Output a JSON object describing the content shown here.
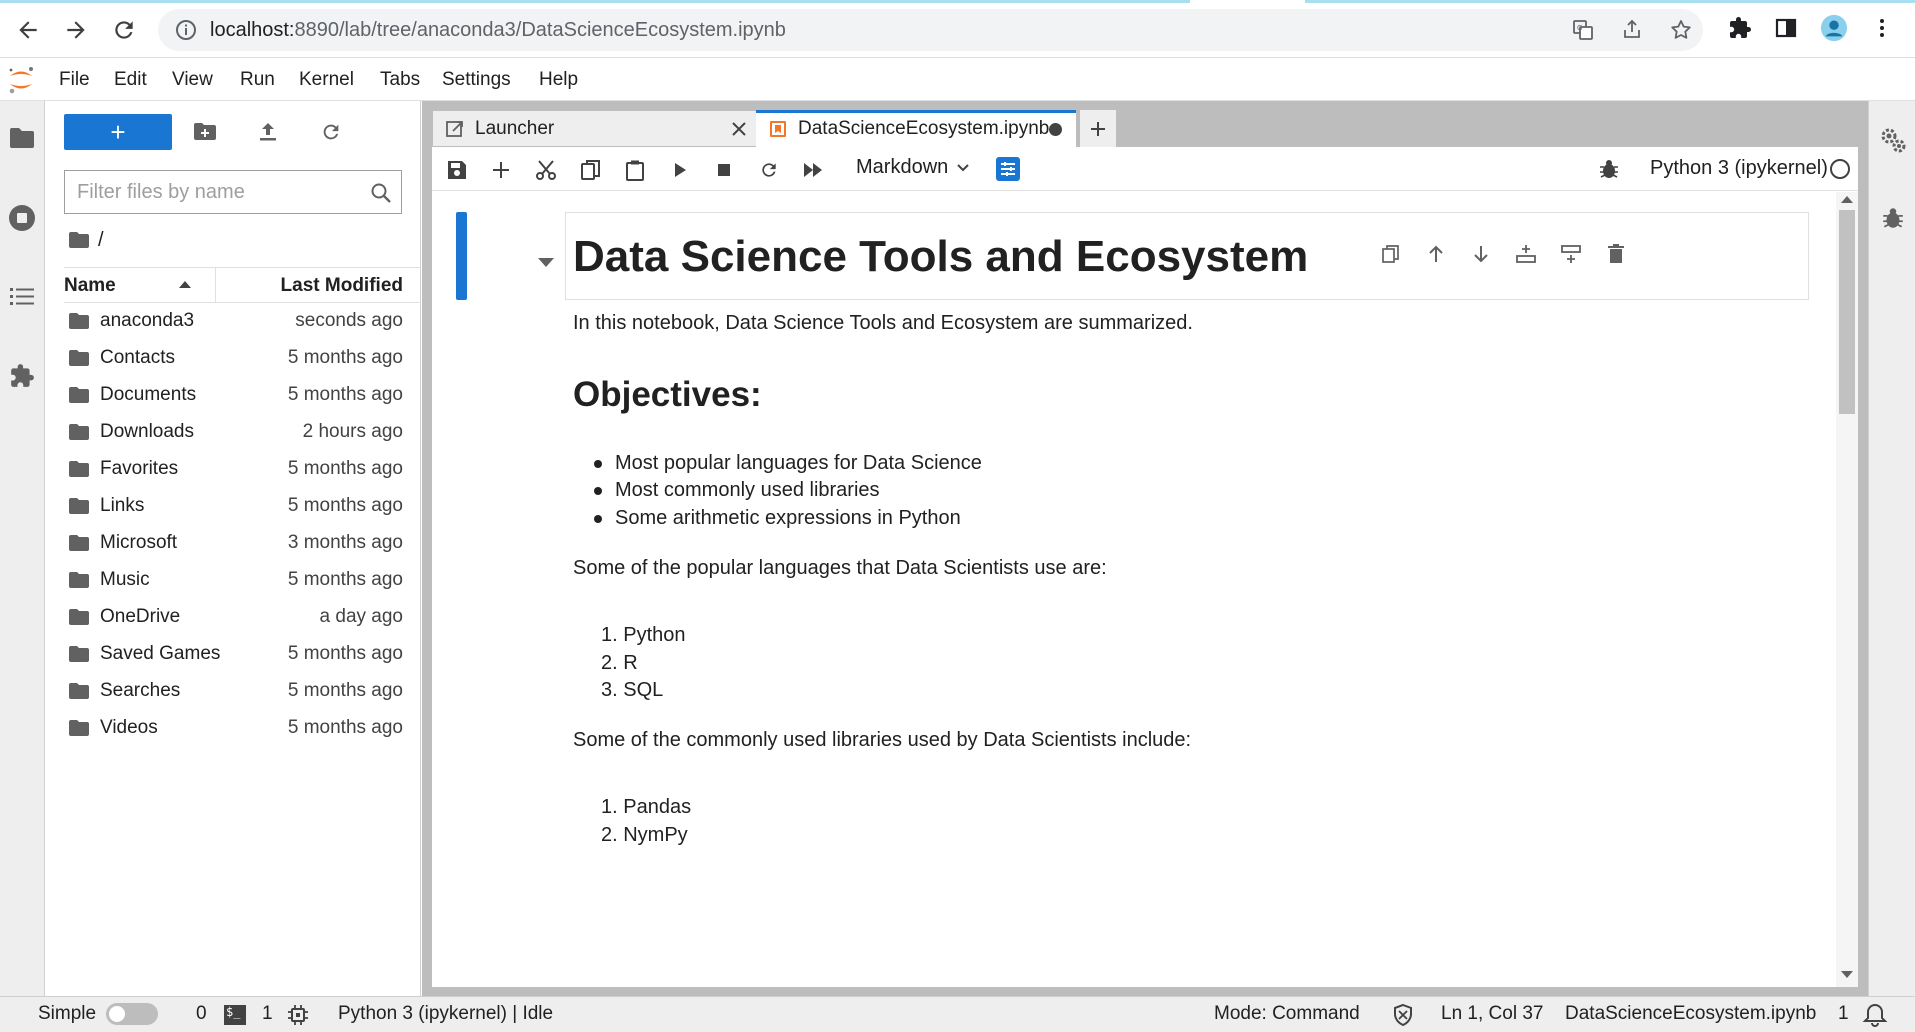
{
  "browser": {
    "url_host": "localhost:",
    "url_rest": "8890/lab/tree/anaconda3/DataScienceEcosystem.ipynb"
  },
  "menubar": {
    "items": [
      "File",
      "Edit",
      "View",
      "Run",
      "Kernel",
      "Tabs",
      "Settings",
      "Help"
    ]
  },
  "filebrowser": {
    "new_label": "+",
    "filter_placeholder": "Filter files by name",
    "breadcrumb": "/",
    "col_name": "Name",
    "col_modified": "Last Modified",
    "files": [
      {
        "name": "anaconda3",
        "modified": "seconds ago"
      },
      {
        "name": "Contacts",
        "modified": "5 months ago"
      },
      {
        "name": "Documents",
        "modified": "5 months ago"
      },
      {
        "name": "Downloads",
        "modified": "2 hours ago"
      },
      {
        "name": "Favorites",
        "modified": "5 months ago"
      },
      {
        "name": "Links",
        "modified": "5 months ago"
      },
      {
        "name": "Microsoft",
        "modified": "3 months ago"
      },
      {
        "name": "Music",
        "modified": "5 months ago"
      },
      {
        "name": "OneDrive",
        "modified": "a day ago"
      },
      {
        "name": "Saved Games",
        "modified": "5 months ago"
      },
      {
        "name": "Searches",
        "modified": "5 months ago"
      },
      {
        "name": "Videos",
        "modified": "5 months ago"
      }
    ]
  },
  "tabs": {
    "launcher": "Launcher",
    "notebook": "DataScienceEcosystem.ipynb",
    "add": "+"
  },
  "toolbar": {
    "cell_type": "Markdown",
    "kernel": "Python 3 (ipykernel)"
  },
  "notebook": {
    "h1": "Data Science Tools and Ecosystem",
    "intro": "In this notebook, Data Science Tools and Ecosystem are summarized.",
    "objectives_heading": "Objectives:",
    "objectives": [
      "Most popular languages for Data Science",
      "Most commonly used libraries",
      "Some arithmetic expressions in Python"
    ],
    "languages_intro": "Some of the popular languages that Data Scientists use are:",
    "languages": [
      "1. Python",
      "2. R",
      "3. SQL"
    ],
    "libraries_intro": "Some of the commonly used libraries used by Data Scientists include:",
    "libraries": [
      "1. Pandas",
      "2. NymPy"
    ]
  },
  "statusbar": {
    "simple": "Simple",
    "terminals_count_a": "0",
    "terminals_count_b": "1",
    "kernel_status": "Python 3 (ipykernel) | Idle",
    "mode": "Mode: Command",
    "position": "Ln 1, Col 37",
    "filename": "DataScienceEcosystem.ipynb",
    "notifications": "1"
  },
  "colors": {
    "accent": "#1976d2",
    "jupyter_orange": "#f37726"
  }
}
